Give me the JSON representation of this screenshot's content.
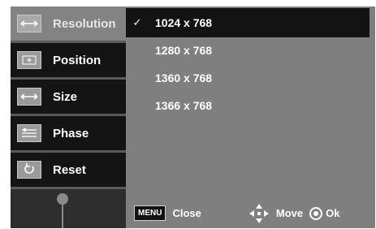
{
  "sidebar": {
    "items": [
      {
        "label": "Resolution",
        "icon": "horizontal-arrows-icon",
        "active": true
      },
      {
        "label": "Position",
        "icon": "position-icon",
        "active": false
      },
      {
        "label": "Size",
        "icon": "horizontal-arrows-icon",
        "active": false
      },
      {
        "label": "Phase",
        "icon": "phase-icon",
        "active": false
      },
      {
        "label": "Reset",
        "icon": "reset-icon",
        "active": false
      }
    ]
  },
  "resolutions": {
    "items": [
      "1024 x 768",
      "1280 x 768",
      "1360 x 768",
      "1366 x 768"
    ],
    "selected": "1024 x 768",
    "check_mark": "✓"
  },
  "footer": {
    "menu_key": "MENU",
    "close_label": "Close",
    "move_label": "Move",
    "ok_label": "Ok"
  },
  "colors": {
    "active_item": "#838383",
    "selected_row": "#131313",
    "panel": "#7f7f7f"
  }
}
